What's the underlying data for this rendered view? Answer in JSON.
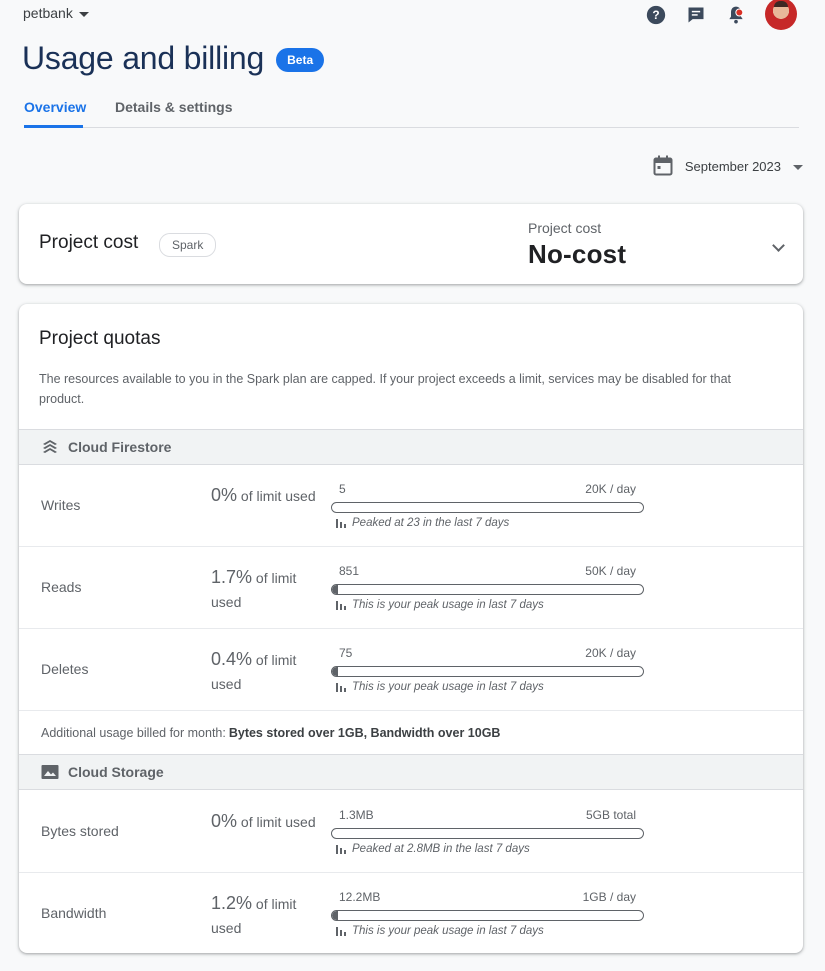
{
  "topbar": {
    "project_name": "petbank",
    "icons": [
      "help-icon",
      "feedback-icon",
      "notifications-icon",
      "avatar"
    ]
  },
  "header": {
    "title": "Usage and billing",
    "badge": "Beta",
    "tabs": [
      {
        "label": "Overview",
        "active": true
      },
      {
        "label": "Details & settings",
        "active": false
      }
    ],
    "month": "September 2023"
  },
  "cost_card": {
    "title": "Project cost",
    "plan": "Spark",
    "label": "Project cost",
    "value": "No-cost"
  },
  "quotas": {
    "title": "Project quotas",
    "description": "The resources available to you in the Spark plan are capped. If your project exceeds a limit, services may be disabled for that product.",
    "limit_suffix": "of limit used",
    "firestore": {
      "name": "Cloud Firestore",
      "rows": [
        {
          "name": "Writes",
          "pct": "0%",
          "usage": "5",
          "limit": "20K / day",
          "note": "Peaked at 23 in the last 7 days",
          "fill": 0
        },
        {
          "name": "Reads",
          "pct": "1.7%",
          "usage": "851",
          "limit": "50K / day",
          "note": "This is your peak usage in last 7 days",
          "fill": 0.017
        },
        {
          "name": "Deletes",
          "pct": "0.4%",
          "usage": "75",
          "limit": "20K / day",
          "note": "This is your peak usage in last 7 days",
          "fill": 0.004
        }
      ],
      "additional_label": "Additional usage billed for month:",
      "additional_items": "Bytes stored over 1GB, Bandwidth over 10GB"
    },
    "storage": {
      "name": "Cloud Storage",
      "rows": [
        {
          "name": "Bytes stored",
          "pct": "0%",
          "usage": "1.3MB",
          "limit": "5GB total",
          "note": "Peaked at 2.8MB in the last 7 days",
          "fill": 0
        },
        {
          "name": "Bandwidth",
          "pct": "1.2%",
          "usage": "12.2MB",
          "limit": "1GB / day",
          "note": "This is your peak usage in last 7 days",
          "fill": 0.012
        }
      ]
    }
  },
  "colors": {
    "accent": "#1a73e8",
    "title": "#1a3157",
    "muted": "#5f6368"
  }
}
